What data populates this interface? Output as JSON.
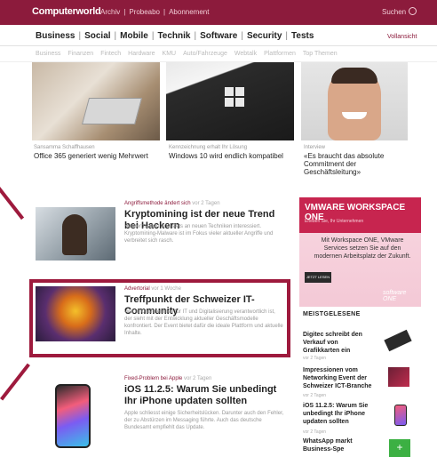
{
  "topbar": {
    "logo": "Computerworld",
    "links": [
      "Archiv",
      "|",
      "Probeabo",
      "|",
      "Abonnement"
    ],
    "search": "Suchen"
  },
  "nav": {
    "items": [
      "Business",
      "|",
      "Social",
      "|",
      "Mobile",
      "|",
      "Technik",
      "|",
      "Software",
      "|",
      "Security",
      "|",
      "Tests"
    ],
    "vollansicht": "Vollansicht"
  },
  "subnav": [
    "Business",
    "Finanzen",
    "Fintech",
    "Hardware",
    "KMU",
    "Auto/Fahrzeuge",
    "Webtalk",
    "Plattformen",
    "Top Themen"
  ],
  "teasers": [
    {
      "caption": "Sansamma Schaffhausen",
      "title": "Office 365 generiert wenig Mehrwert"
    },
    {
      "caption": "Kennzeichnung erhalt Ihr Lösung",
      "title": "Windows 10 wird endlich kompatibel"
    },
    {
      "caption": "Interview",
      "title": "«Es braucht das absolute Commitment der Geschäftsleitung»"
    }
  ],
  "articles": [
    {
      "kicker": "Angriffsmethode ändert sich",
      "date": "vor 2 Tagen",
      "title": "Kryptomining ist der neue Trend bei Hackern",
      "body": "Hackerbanden sind stets an neuen Techniken interessiert. Kryptomining-Malware ist im Fokus vieler aktueller Angriffe und verbreitet sich rasch."
    },
    {
      "kicker": "Advertorial",
      "date": "vor 1 Woche",
      "title": "Treffpunkt der Schweizer IT-Community",
      "body": "Wer in Unternehmen für IT und Digitalisierung verantwortlich ist, der sieht mit der Entwicklung aktueller Geschäftsmodelle konfrontiert. Der Event bietet dafür die ideale Plattform und aktuelle Inhalte."
    },
    {
      "kicker": "Fixed-Problem bei Apple",
      "date": "vor 2 Tagen",
      "title": "iOS 11.2.5: Warum Sie unbedingt Ihr iPhone updaten sollten",
      "body": "Apple schliesst einige Sicherheitslücken. Darunter auch den Fehler, der zu Abstürzen im Messaging führte. Auch das deutsche Bundesamt empfiehlt das Update."
    }
  ],
  "ad": {
    "headline": "VMWARE WORKSPACE ONE",
    "subline": "Erleben Sie, Ihr Unternehmen",
    "body": "Mit Workspace ONE, VMware Services setzen Sie auf den modernen Arbeitsplatz der Zukunft.",
    "button": "JETZT LESEN",
    "logo": "software ONE"
  },
  "sidebar": {
    "title": "MEISTGELESENE",
    "items": [
      {
        "title": "Digitec schreibt den Verkauf von Grafikkarten ein",
        "date": "vor 2 Tagen"
      },
      {
        "title": "Impressionen vom Networking Event der Schweizer ICT-Branche",
        "date": "vor 2 Tagen"
      },
      {
        "title": "iOS 11.2.5: Warum Sie unbedingt Ihr iPhone updaten sollten",
        "date": "vor 2 Tagen"
      },
      {
        "title": "WhatsApp markt Business-Spe",
        "date": ""
      }
    ]
  },
  "colors": {
    "brand": "#8c1b3c",
    "highlight": "#9e1a3d",
    "ad": "#c7254f"
  }
}
